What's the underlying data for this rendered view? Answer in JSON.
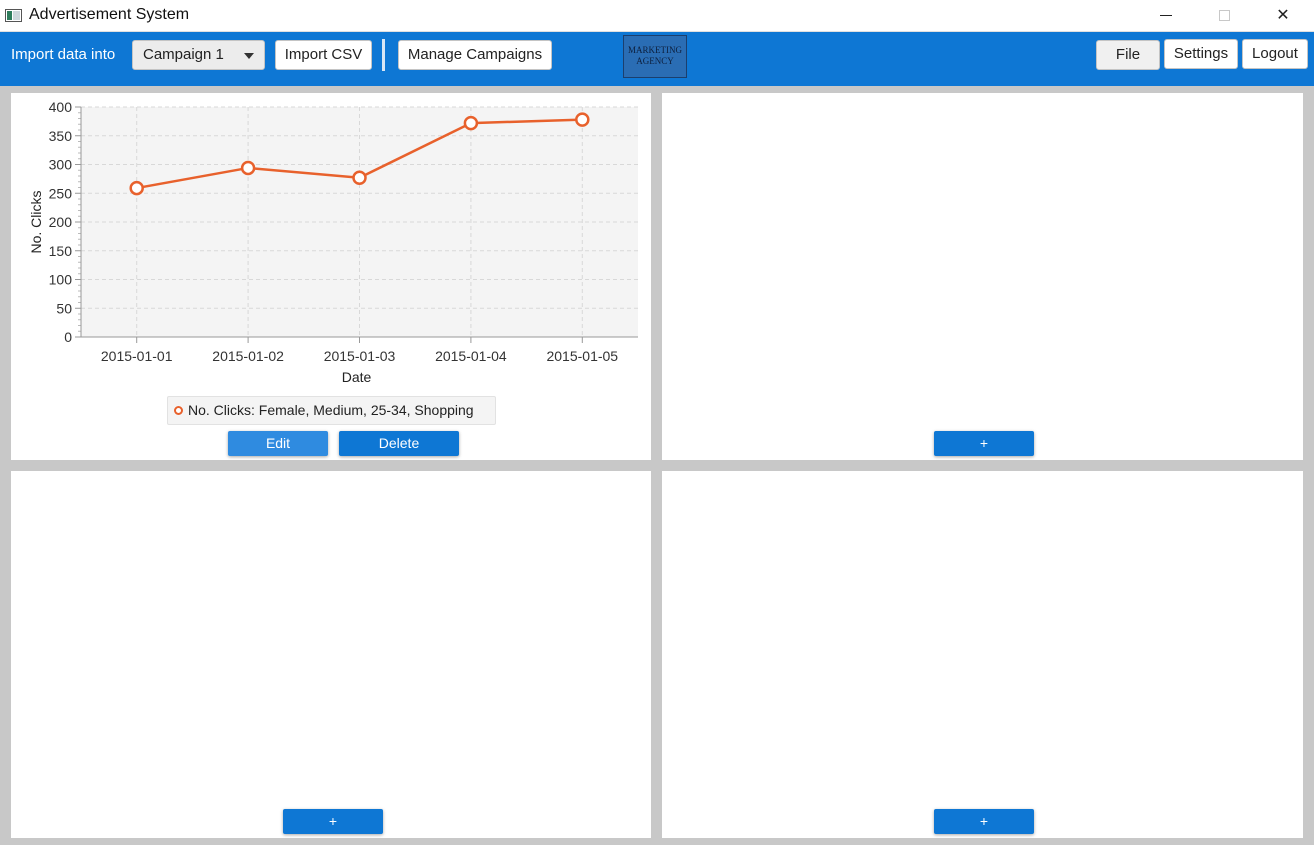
{
  "window": {
    "title": "Advertisement System",
    "close_glyph": "✕"
  },
  "toolbar": {
    "import_label": "Import data into",
    "campaign_selected": "Campaign 1",
    "import_csv": "Import CSV",
    "manage_campaigns": "Manage Campaigns",
    "logo_line1": "MARKETING",
    "logo_line2": "AGENCY",
    "file": "File",
    "settings": "Settings",
    "logout": "Logout"
  },
  "panels": {
    "edit": "Edit",
    "delete": "Delete",
    "add": "+"
  },
  "chart_data": {
    "type": "line",
    "categories": [
      "2015-01-01",
      "2015-01-02",
      "2015-01-03",
      "2015-01-04",
      "2015-01-05"
    ],
    "series": [
      {
        "name": "No. Clicks: Female, Medium, 25-34, Shopping",
        "values": [
          259,
          294,
          277,
          372,
          378
        ],
        "color": "#e8612c"
      }
    ],
    "xlabel": "Date",
    "ylabel": "No. Clicks",
    "ylim": [
      0,
      400
    ],
    "yticks": [
      0,
      50,
      100,
      150,
      200,
      250,
      300,
      350,
      400
    ],
    "grid": true,
    "legend_position": "bottom"
  }
}
